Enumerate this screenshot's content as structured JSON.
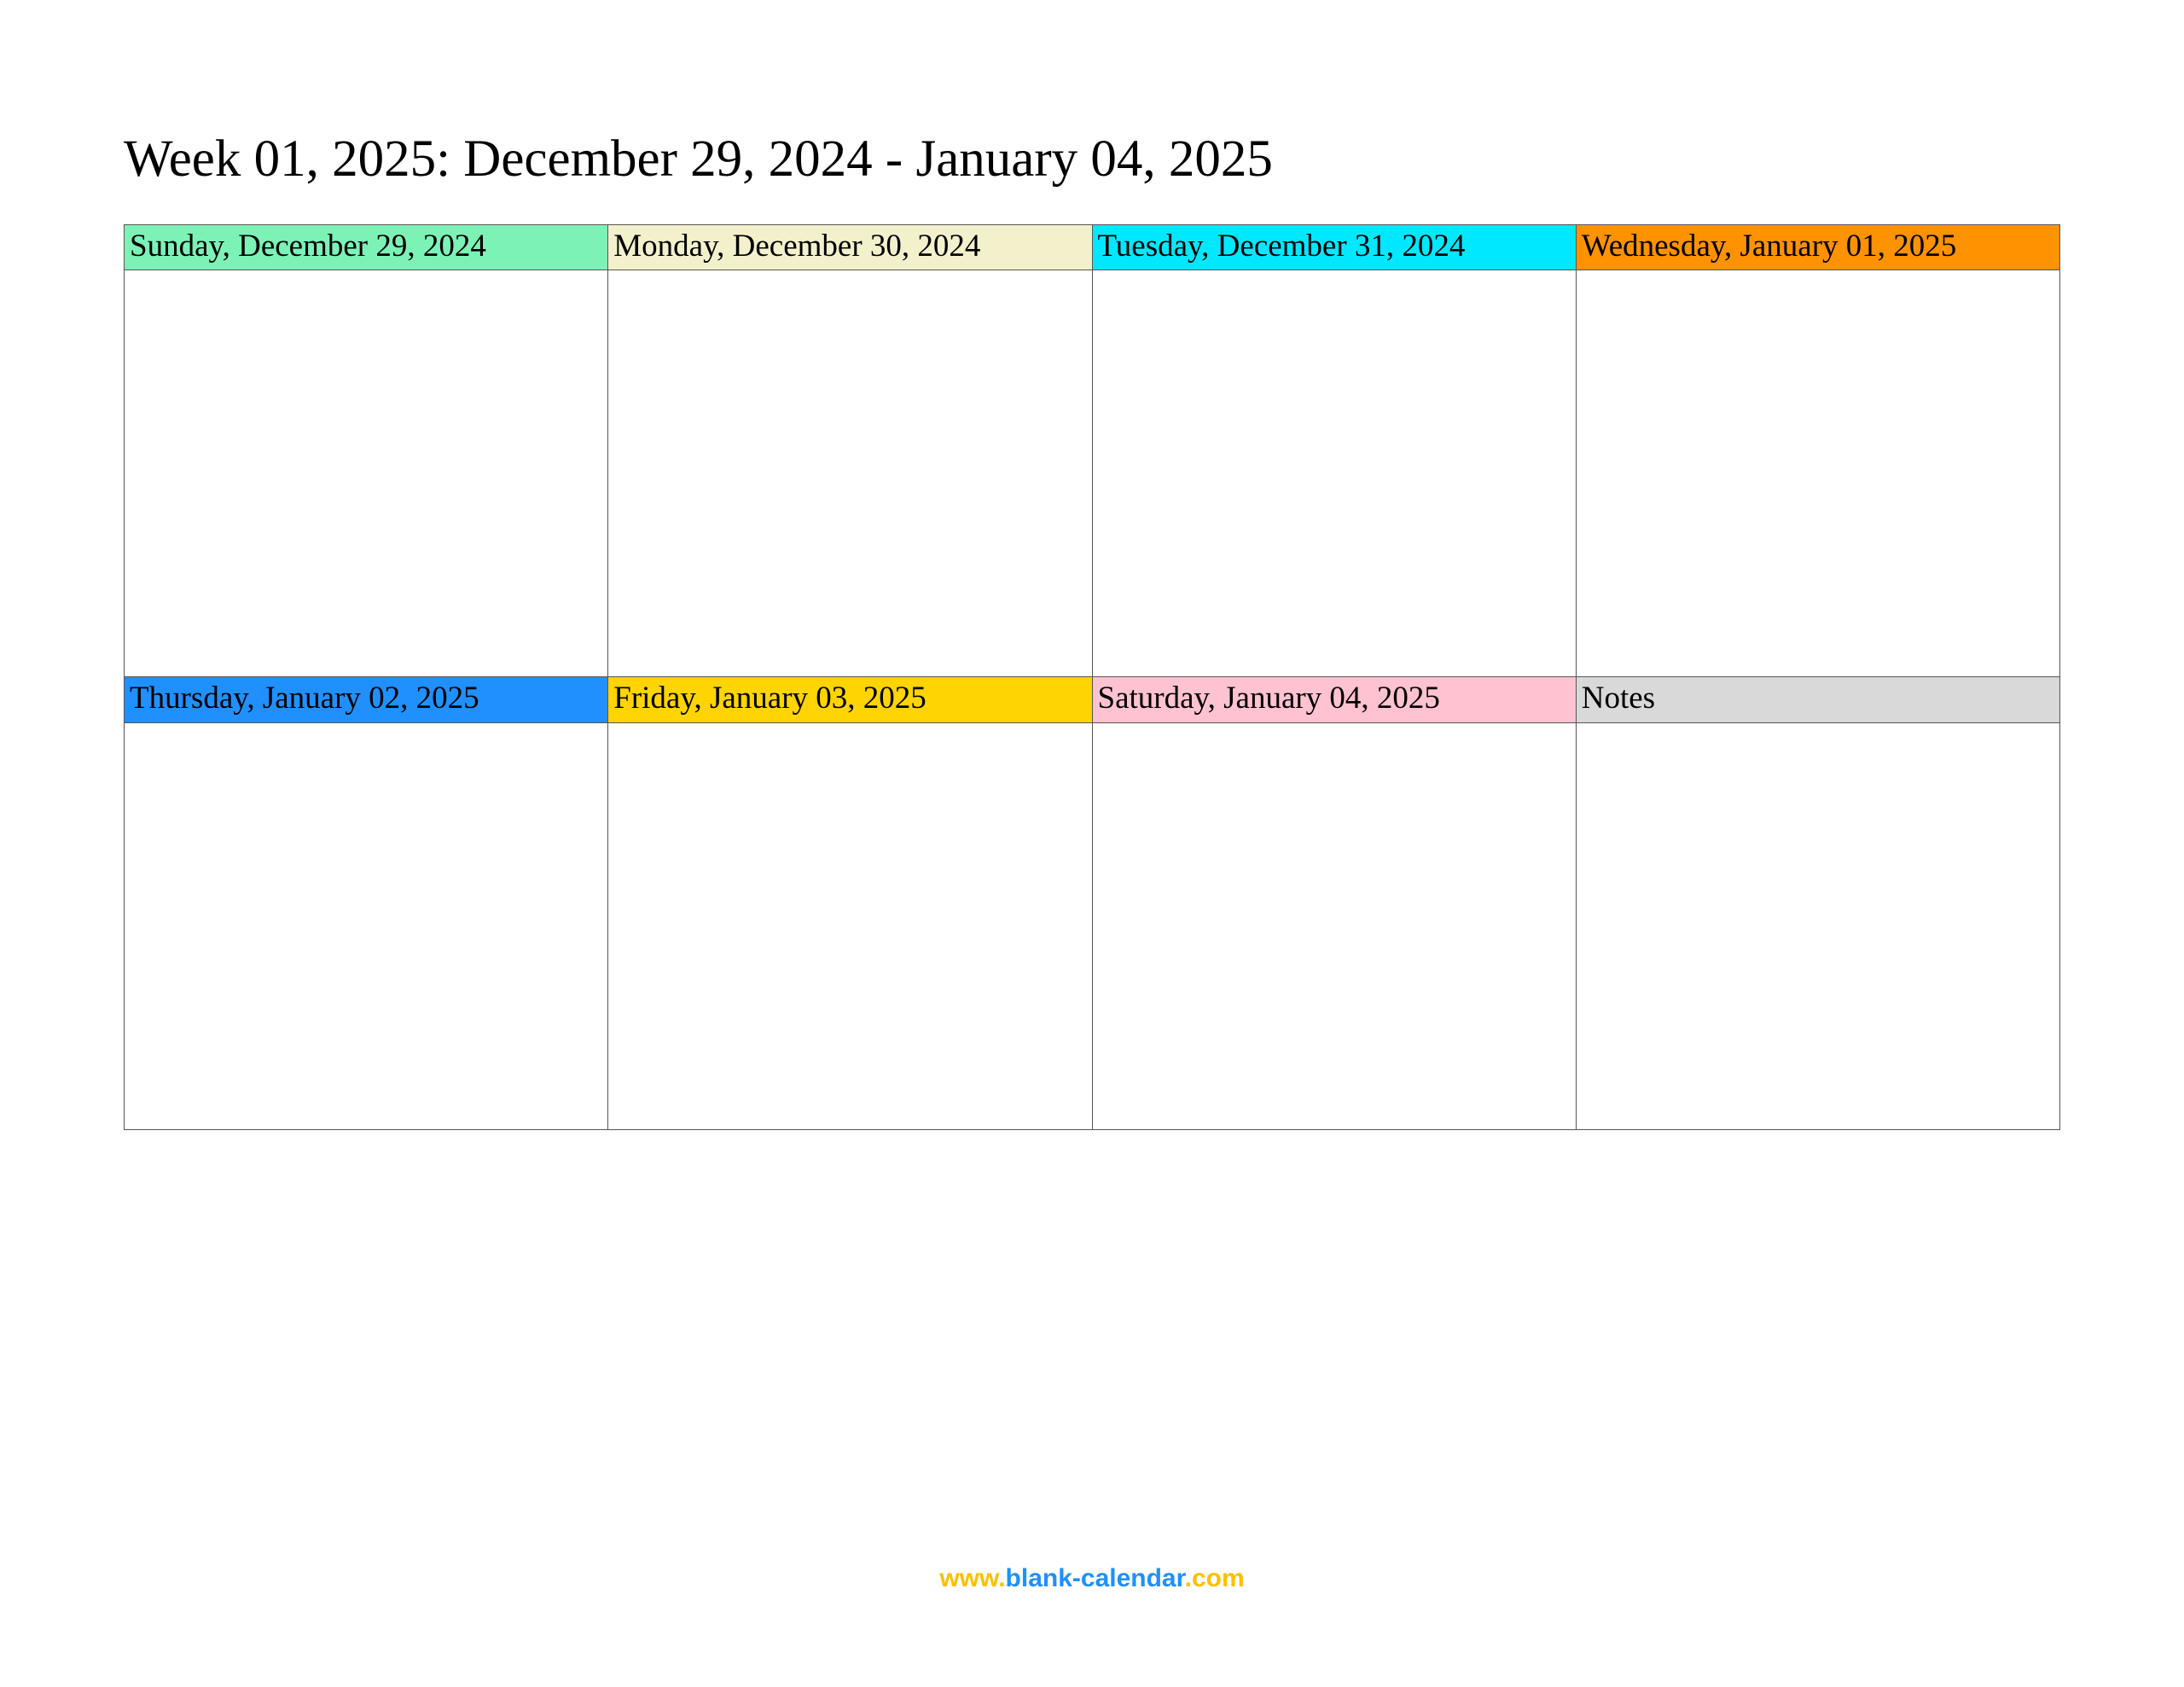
{
  "title": "Week 01, 2025: December 29, 2024 - January 04, 2025",
  "cells": {
    "row1": [
      {
        "label": "Sunday, December 29, 2024",
        "class": "hdr-sunday"
      },
      {
        "label": "Monday, December 30, 2024",
        "class": "hdr-monday"
      },
      {
        "label": "Tuesday, December 31, 2024",
        "class": "hdr-tuesday"
      },
      {
        "label": "Wednesday, January 01, 2025",
        "class": "hdr-wednesday"
      }
    ],
    "row2": [
      {
        "label": "Thursday, January 02, 2025",
        "class": "hdr-thursday"
      },
      {
        "label": "Friday, January 03, 2025",
        "class": "hdr-friday"
      },
      {
        "label": "Saturday, January 04, 2025",
        "class": "hdr-saturday"
      },
      {
        "label": "Notes",
        "class": "hdr-notes"
      }
    ]
  },
  "footer": {
    "part_a": "www.",
    "part_b": "blank-calendar",
    "part_c": ".com"
  }
}
